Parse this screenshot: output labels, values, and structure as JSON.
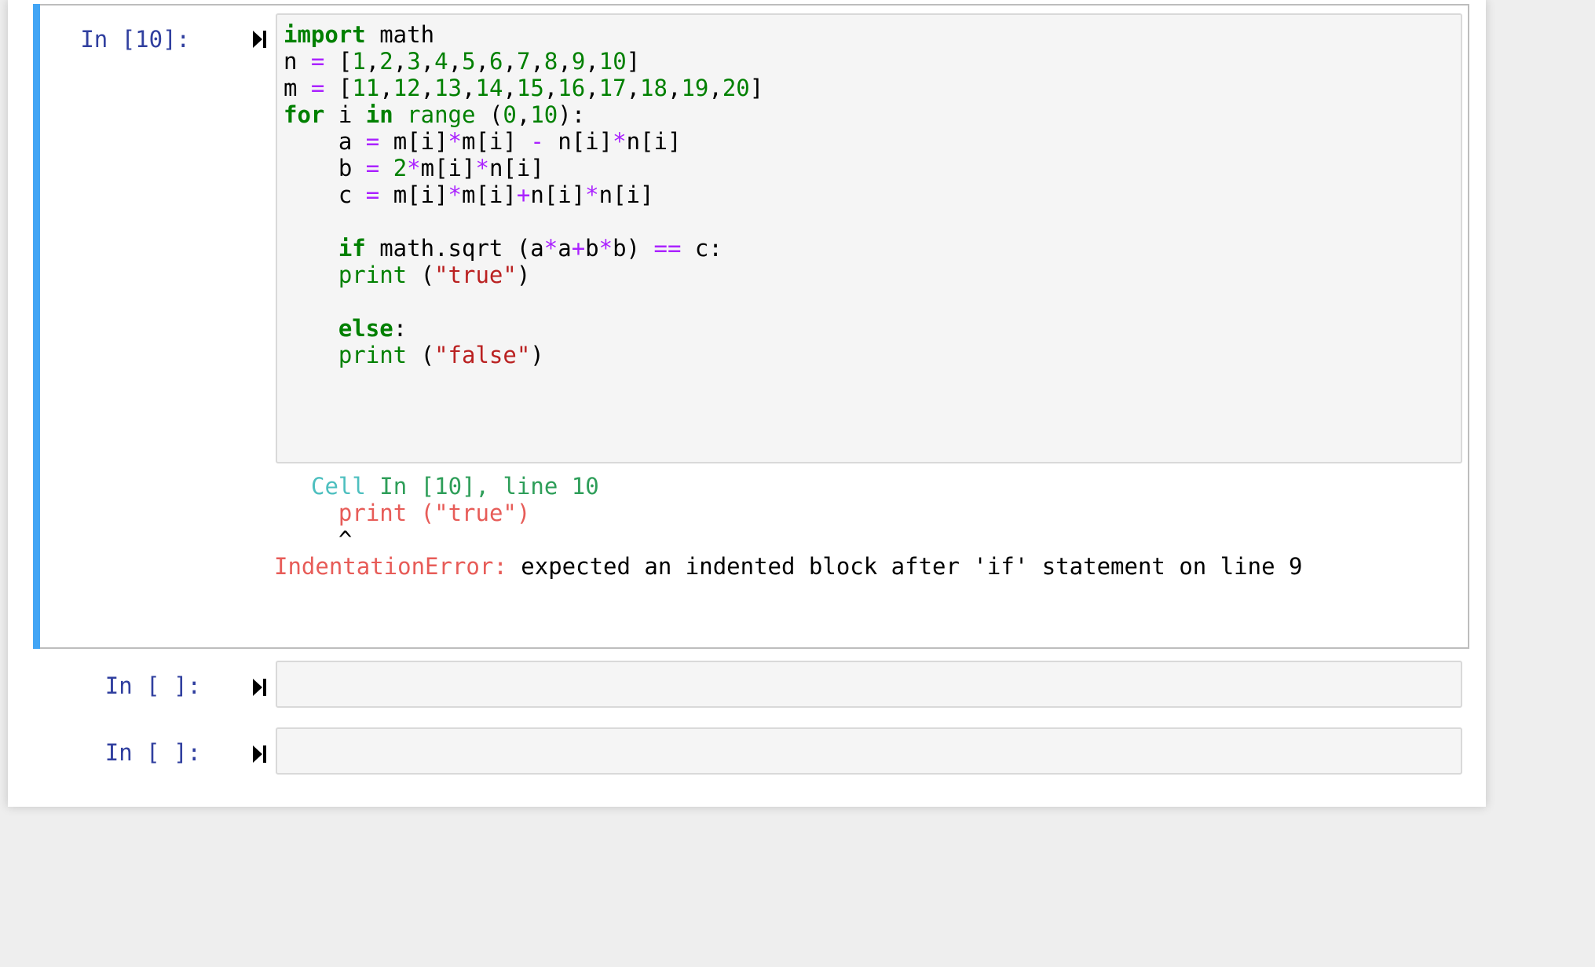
{
  "cells": [
    {
      "prompt": "In [10]:",
      "code_lines": [
        [
          {
            "t": "import",
            "c": "kw"
          },
          {
            "t": " math",
            "c": ""
          }
        ],
        [
          {
            "t": "n ",
            "c": ""
          },
          {
            "t": "=",
            "c": "op"
          },
          {
            "t": " [",
            "c": ""
          },
          {
            "t": "1",
            "c": "num"
          },
          {
            "t": ",",
            "c": ""
          },
          {
            "t": "2",
            "c": "num"
          },
          {
            "t": ",",
            "c": ""
          },
          {
            "t": "3",
            "c": "num"
          },
          {
            "t": ",",
            "c": ""
          },
          {
            "t": "4",
            "c": "num"
          },
          {
            "t": ",",
            "c": ""
          },
          {
            "t": "5",
            "c": "num"
          },
          {
            "t": ",",
            "c": ""
          },
          {
            "t": "6",
            "c": "num"
          },
          {
            "t": ",",
            "c": ""
          },
          {
            "t": "7",
            "c": "num"
          },
          {
            "t": ",",
            "c": ""
          },
          {
            "t": "8",
            "c": "num"
          },
          {
            "t": ",",
            "c": ""
          },
          {
            "t": "9",
            "c": "num"
          },
          {
            "t": ",",
            "c": ""
          },
          {
            "t": "10",
            "c": "num"
          },
          {
            "t": "]",
            "c": ""
          }
        ],
        [
          {
            "t": "m ",
            "c": ""
          },
          {
            "t": "=",
            "c": "op"
          },
          {
            "t": " [",
            "c": ""
          },
          {
            "t": "11",
            "c": "num"
          },
          {
            "t": ",",
            "c": ""
          },
          {
            "t": "12",
            "c": "num"
          },
          {
            "t": ",",
            "c": ""
          },
          {
            "t": "13",
            "c": "num"
          },
          {
            "t": ",",
            "c": ""
          },
          {
            "t": "14",
            "c": "num"
          },
          {
            "t": ",",
            "c": ""
          },
          {
            "t": "15",
            "c": "num"
          },
          {
            "t": ",",
            "c": ""
          },
          {
            "t": "16",
            "c": "num"
          },
          {
            "t": ",",
            "c": ""
          },
          {
            "t": "17",
            "c": "num"
          },
          {
            "t": ",",
            "c": ""
          },
          {
            "t": "18",
            "c": "num"
          },
          {
            "t": ",",
            "c": ""
          },
          {
            "t": "19",
            "c": "num"
          },
          {
            "t": ",",
            "c": ""
          },
          {
            "t": "20",
            "c": "num"
          },
          {
            "t": "]",
            "c": ""
          }
        ],
        [
          {
            "t": "for",
            "c": "kw"
          },
          {
            "t": " i ",
            "c": ""
          },
          {
            "t": "in",
            "c": "kw"
          },
          {
            "t": " ",
            "c": ""
          },
          {
            "t": "range",
            "c": "bi"
          },
          {
            "t": " (",
            "c": ""
          },
          {
            "t": "0",
            "c": "num"
          },
          {
            "t": ",",
            "c": ""
          },
          {
            "t": "10",
            "c": "num"
          },
          {
            "t": "):",
            "c": ""
          }
        ],
        [
          {
            "t": "    a ",
            "c": ""
          },
          {
            "t": "=",
            "c": "op"
          },
          {
            "t": " m[i]",
            "c": ""
          },
          {
            "t": "*",
            "c": "op"
          },
          {
            "t": "m[i] ",
            "c": ""
          },
          {
            "t": "-",
            "c": "op"
          },
          {
            "t": " n[i]",
            "c": ""
          },
          {
            "t": "*",
            "c": "op"
          },
          {
            "t": "n[i]",
            "c": ""
          }
        ],
        [
          {
            "t": "    b ",
            "c": ""
          },
          {
            "t": "=",
            "c": "op"
          },
          {
            "t": " ",
            "c": ""
          },
          {
            "t": "2",
            "c": "num"
          },
          {
            "t": "*",
            "c": "op"
          },
          {
            "t": "m[i]",
            "c": ""
          },
          {
            "t": "*",
            "c": "op"
          },
          {
            "t": "n[i]",
            "c": ""
          }
        ],
        [
          {
            "t": "    c ",
            "c": ""
          },
          {
            "t": "=",
            "c": "op"
          },
          {
            "t": " m[i]",
            "c": ""
          },
          {
            "t": "*",
            "c": "op"
          },
          {
            "t": "m[i]",
            "c": ""
          },
          {
            "t": "+",
            "c": "op"
          },
          {
            "t": "n[i]",
            "c": ""
          },
          {
            "t": "*",
            "c": "op"
          },
          {
            "t": "n[i]",
            "c": ""
          }
        ],
        [],
        [
          {
            "t": "    ",
            "c": ""
          },
          {
            "t": "if",
            "c": "kw"
          },
          {
            "t": " math.sqrt (a",
            "c": ""
          },
          {
            "t": "*",
            "c": "op"
          },
          {
            "t": "a",
            "c": ""
          },
          {
            "t": "+",
            "c": "op"
          },
          {
            "t": "b",
            "c": ""
          },
          {
            "t": "*",
            "c": "op"
          },
          {
            "t": "b) ",
            "c": ""
          },
          {
            "t": "==",
            "c": "op"
          },
          {
            "t": " c:",
            "c": ""
          }
        ],
        [
          {
            "t": "    ",
            "c": ""
          },
          {
            "t": "print",
            "c": "bi"
          },
          {
            "t": " (",
            "c": ""
          },
          {
            "t": "\"true\"",
            "c": "str"
          },
          {
            "t": ")",
            "c": ""
          }
        ],
        [],
        [
          {
            "t": "    ",
            "c": ""
          },
          {
            "t": "else",
            "c": "kw"
          },
          {
            "t": ":",
            "c": ""
          }
        ],
        [
          {
            "t": "    ",
            "c": ""
          },
          {
            "t": "print",
            "c": "bi"
          },
          {
            "t": " (",
            "c": ""
          },
          {
            "t": "\"false\"",
            "c": "str"
          },
          {
            "t": ")",
            "c": ""
          }
        ]
      ],
      "output": {
        "tb_cell": "Cell",
        "tb_loc": " In [10], line 10",
        "tb_line": "  print (\"true\")",
        "tb_caret": "  ^",
        "error_name": "IndentationError:",
        "error_msg": " expected an indented block after 'if' statement on line 9"
      }
    },
    {
      "prompt": "In [ ]:"
    },
    {
      "prompt": "In [ ]:"
    }
  ],
  "colors": {
    "selected_bar": "#42a5f5",
    "prompt": "#303f9f",
    "keyword": "#008000",
    "operator": "#aa22ff",
    "string": "#ba2121",
    "error": "#e75c58"
  },
  "icons": {
    "run": "run-cell-icon"
  }
}
